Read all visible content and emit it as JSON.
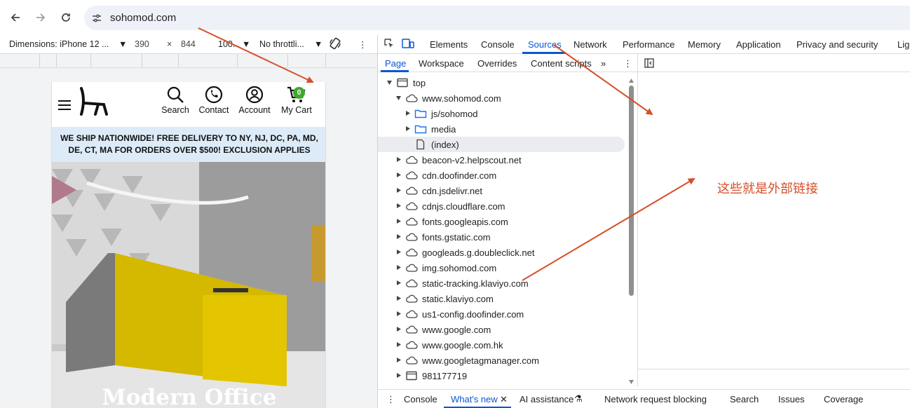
{
  "browser": {
    "url": "sohomod.com"
  },
  "device_toolbar": {
    "dimensions_label": "Dimensions: iPhone 12 ...",
    "width": "390",
    "times": "×",
    "height": "844",
    "zoom": "100...",
    "throttle": "No throttli..."
  },
  "site": {
    "header_items": [
      {
        "label": "Search",
        "icon": "search-icon"
      },
      {
        "label": "Contact",
        "icon": "phone-icon"
      },
      {
        "label": "Account",
        "icon": "account-icon"
      },
      {
        "label": "My Cart",
        "icon": "cart-icon"
      }
    ],
    "cart_count": "0",
    "banner": "WE SHIP NATIONWIDE! FREE DELIVERY TO NY, NJ, DC, PA, MD, DE, CT, MA FOR ORDERS OVER $500! EXCLUSION APPLIES",
    "hero_title": "Modern Office"
  },
  "devtools": {
    "tabs": [
      "Elements",
      "Console",
      "Sources",
      "Network",
      "Performance",
      "Memory",
      "Application",
      "Privacy and security",
      "Lig"
    ],
    "active_tab": "Sources",
    "subtabs": [
      "Page",
      "Workspace",
      "Overrides",
      "Content scripts"
    ],
    "active_subtab": "Page",
    "tree": [
      {
        "label": "top",
        "type": "frame",
        "depth": 0,
        "expanded": true
      },
      {
        "label": "www.sohomod.com",
        "type": "cloud",
        "depth": 1,
        "expanded": true
      },
      {
        "label": "js/sohomod",
        "type": "folder",
        "depth": 2,
        "expanded": false
      },
      {
        "label": "media",
        "type": "folder",
        "depth": 2,
        "expanded": false
      },
      {
        "label": "(index)",
        "type": "file",
        "depth": 2,
        "selected": true
      },
      {
        "label": "beacon-v2.helpscout.net",
        "type": "cloud",
        "depth": 1
      },
      {
        "label": "cdn.doofinder.com",
        "type": "cloud",
        "depth": 1
      },
      {
        "label": "cdn.jsdelivr.net",
        "type": "cloud",
        "depth": 1
      },
      {
        "label": "cdnjs.cloudflare.com",
        "type": "cloud",
        "depth": 1
      },
      {
        "label": "fonts.googleapis.com",
        "type": "cloud",
        "depth": 1
      },
      {
        "label": "fonts.gstatic.com",
        "type": "cloud",
        "depth": 1
      },
      {
        "label": "googleads.g.doubleclick.net",
        "type": "cloud",
        "depth": 1
      },
      {
        "label": "img.sohomod.com",
        "type": "cloud",
        "depth": 1
      },
      {
        "label": "static-tracking.klaviyo.com",
        "type": "cloud",
        "depth": 1
      },
      {
        "label": "static.klaviyo.com",
        "type": "cloud",
        "depth": 1
      },
      {
        "label": "us1-config.doofinder.com",
        "type": "cloud",
        "depth": 1
      },
      {
        "label": "www.google.com",
        "type": "cloud",
        "depth": 1
      },
      {
        "label": "www.google.com.hk",
        "type": "cloud",
        "depth": 1
      },
      {
        "label": "www.googletagmanager.com",
        "type": "cloud",
        "depth": 1
      },
      {
        "label": "981177719",
        "type": "frame",
        "depth": 1
      }
    ],
    "drawer_tabs": [
      "Console",
      "What's new",
      "AI assistance",
      "Network request blocking",
      "Search",
      "Issues",
      "Coverage"
    ],
    "active_drawer_tab": "What's new"
  },
  "annotation": "这些就是外部链接",
  "colors": {
    "accent": "#0b57d0",
    "annotation": "#d64f2a",
    "banner_bg": "#dcebf7",
    "cart_badge": "#41a82e"
  }
}
